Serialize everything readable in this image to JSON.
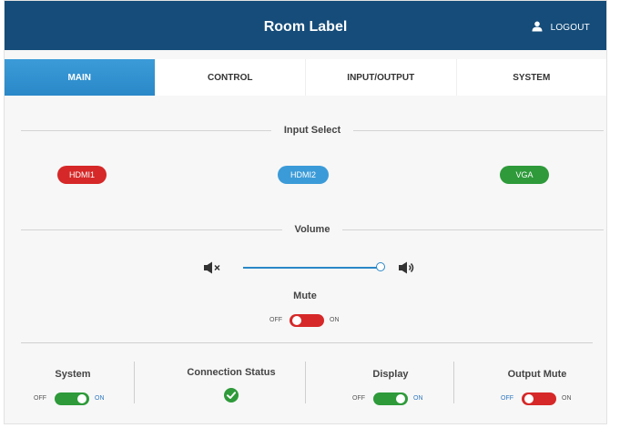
{
  "header": {
    "title": "Room Label",
    "logout_label": "LOGOUT",
    "bg_color": "#154c79"
  },
  "tabs": [
    {
      "label": "MAIN",
      "active": true
    },
    {
      "label": "CONTROL",
      "active": false
    },
    {
      "label": "INPUT/OUTPUT",
      "active": false
    },
    {
      "label": "SYSTEM",
      "active": false
    }
  ],
  "input_select": {
    "title": "Input Select",
    "inputs": [
      {
        "label": "HDMI1",
        "color": "#d62828"
      },
      {
        "label": "HDMI2",
        "color": "#3b9bd8"
      },
      {
        "label": "VGA",
        "color": "#2e9a3a"
      }
    ]
  },
  "volume": {
    "title": "Volume",
    "level_percent": 100
  },
  "mute": {
    "title": "Mute",
    "off_label": "OFF",
    "on_label": "ON",
    "state": "off"
  },
  "status": {
    "system": {
      "title": "System",
      "off_label": "OFF",
      "on_label": "ON",
      "state": "on"
    },
    "connection": {
      "title": "Connection Status",
      "state": "connected"
    },
    "display": {
      "title": "Display",
      "off_label": "OFF",
      "on_label": "ON",
      "state": "on"
    },
    "output_mute": {
      "title": "Output Mute",
      "off_label": "OFF",
      "on_label": "ON",
      "state": "off"
    }
  },
  "colors": {
    "toggle_on": "#2e9a3a",
    "toggle_off": "#d62828",
    "accent": "#2a88c8"
  },
  "icons": [
    "user-icon",
    "speaker-mute-icon",
    "speaker-loud-icon",
    "check-circle-icon"
  ]
}
